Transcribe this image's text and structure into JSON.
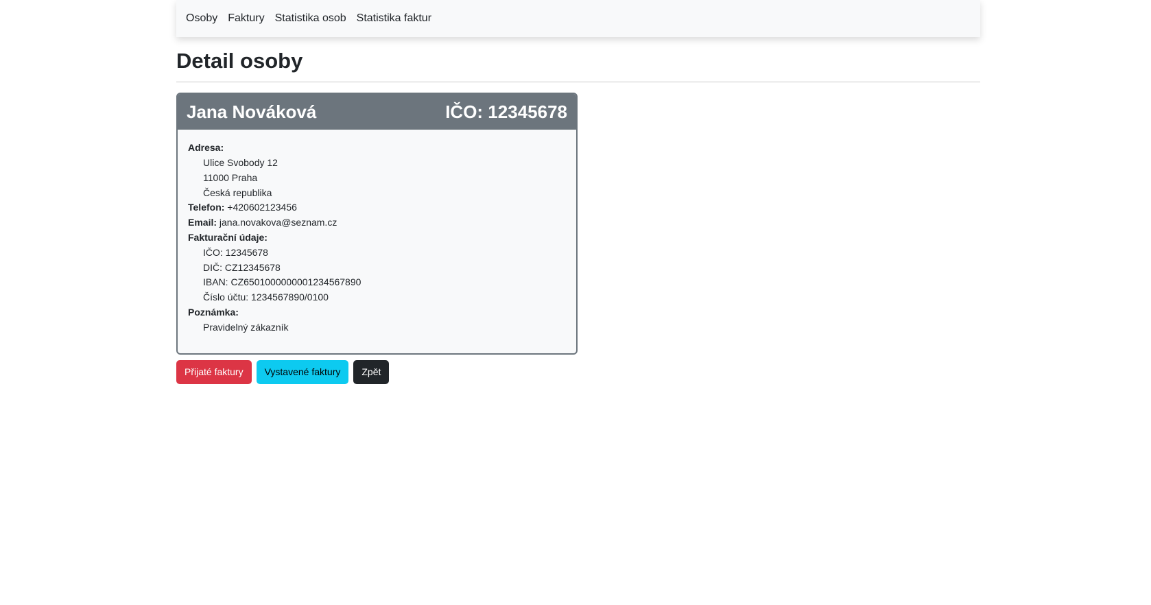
{
  "nav": {
    "items": [
      "Osoby",
      "Faktury",
      "Statistika osob",
      "Statistika faktur"
    ]
  },
  "page": {
    "title": "Detail osoby"
  },
  "person": {
    "name": "Jana Nováková",
    "header_ico": "IČO: 12345678",
    "address_label": "Adresa:",
    "street": "Ulice Svobody 12",
    "city": "11000 Praha",
    "country": "Česká republika",
    "phone_label": "Telefon:",
    "phone": "+420602123456",
    "email_label": "Email:",
    "email": "jana.novakova@seznam.cz",
    "billing_label": "Fakturační údaje:",
    "ico": "IČO: 12345678",
    "dic": "DIČ: CZ12345678",
    "iban": "IBAN: CZ6501000000001234567890",
    "account": "Číslo účtu: 1234567890/0100",
    "note_label": "Poznámka:",
    "note": "Pravidelný zákazník"
  },
  "actions": {
    "received": "Přijaté faktury",
    "issued": "Vystavené faktury",
    "back": "Zpět"
  },
  "colors": {
    "header_bg": "#6c757d",
    "danger": "#dc3545",
    "info": "#0dcaf0",
    "dark": "#212529"
  }
}
